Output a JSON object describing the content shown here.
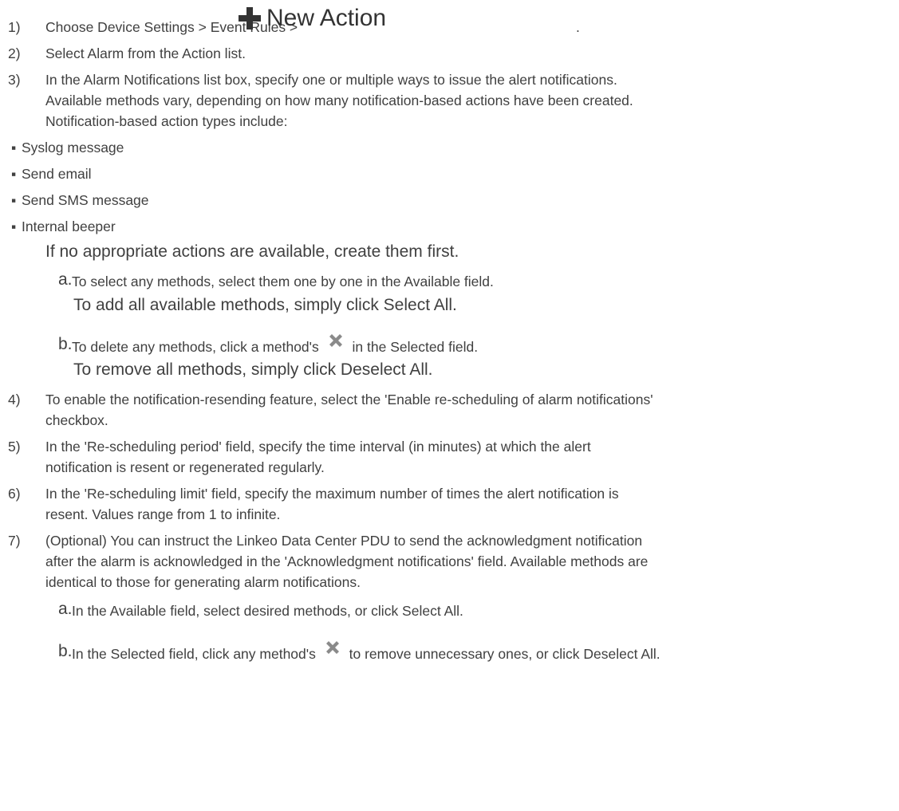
{
  "steps": {
    "s1": {
      "num": "1)",
      "text": "Choose Device Settings > Event Rules >",
      "button_label": "New Action",
      "button_icon": "plus-icon",
      "trail": "."
    },
    "s2": {
      "num": "2)",
      "text": "Select Alarm from the Action list."
    },
    "s3": {
      "num": "3)",
      "lines": [
        "In the Alarm Notifications list box, specify one or multiple ways to issue the alert notifications.",
        "Available methods vary, depending on how many notification-based actions have been created.",
        "Notification-based action types include:"
      ],
      "bullets": [
        "Syslog message",
        "Send email",
        "Send SMS message",
        "Internal beeper"
      ],
      "note": "If no appropriate actions are available, create them first.",
      "a": {
        "letter": "a.",
        "text": "To select any methods, select them one by one in the Available field.",
        "note": "To add all available methods, simply click Select All."
      },
      "b": {
        "letter": "b.",
        "text_before": "To delete any methods, click a method's",
        "icon": "x-icon",
        "text_after": "in the Selected field.",
        "note": "To remove all methods, simply click Deselect All."
      }
    },
    "s4": {
      "num": "4)",
      "lines": [
        "To enable the notification-resending feature, select the 'Enable re-scheduling of alarm notifications'",
        "checkbox."
      ]
    },
    "s5": {
      "num": "5)",
      "lines": [
        "In the 'Re-scheduling period' field, specify the time interval (in minutes) at which the alert",
        "notification is resent or regenerated regularly."
      ]
    },
    "s6": {
      "num": "6)",
      "lines": [
        "In the 'Re-scheduling limit' field, specify the maximum number of times the alert notification is",
        "resent. Values range from 1 to infinite."
      ]
    },
    "s7": {
      "num": "7)",
      "lines": [
        "(Optional) You can instruct the Linkeo Data Center PDU to send the acknowledgment notification",
        "after the alarm is acknowledged in the 'Acknowledgment notifications' field. Available methods are",
        "identical to those for generating alarm notifications."
      ],
      "a": {
        "letter": "a.",
        "text": "In the Available field, select desired methods, or click Select All."
      },
      "b": {
        "letter": "b.",
        "text_before": "In the Selected field, click any method's",
        "icon": "x-icon",
        "text_after": "to remove unnecessary ones, or click Deselect All."
      }
    }
  },
  "colors": {
    "text": "#404040",
    "icon": "#8a8a8a"
  }
}
